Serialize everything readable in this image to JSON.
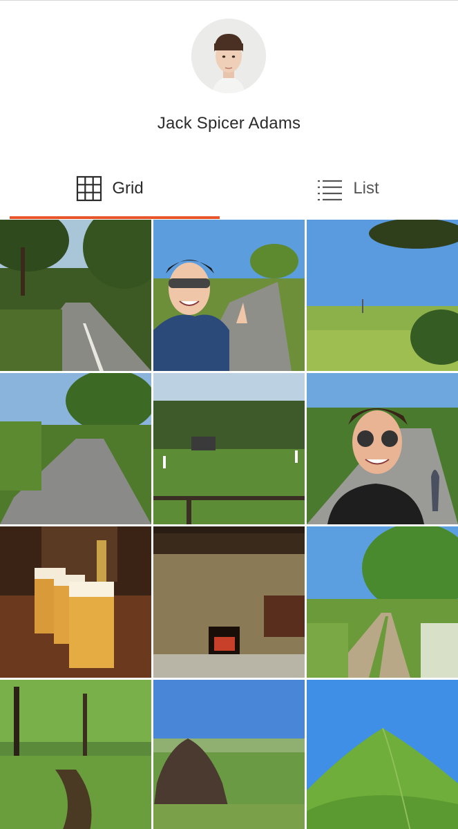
{
  "profile": {
    "name": "Jack Spicer Adams"
  },
  "tabs": {
    "grid": {
      "label": "Grid",
      "icon": "grid-icon",
      "active": true
    },
    "list": {
      "label": "List",
      "icon": "list-icon",
      "active": false
    }
  },
  "colors": {
    "accent": "#e8552a",
    "text": "#2b2b2b",
    "background": "#ffffff"
  },
  "photos": [
    {
      "subject": "country-road-trees"
    },
    {
      "subject": "cyclist-selfie"
    },
    {
      "subject": "green-field-sky"
    },
    {
      "subject": "lane-hedges"
    },
    {
      "subject": "cricket-match"
    },
    {
      "subject": "sunglasses-selfie"
    },
    {
      "subject": "pints-of-beer"
    },
    {
      "subject": "stone-fireplace"
    },
    {
      "subject": "footpath-meadow"
    },
    {
      "subject": "woodland-stream"
    },
    {
      "subject": "rocky-outcrop-view"
    },
    {
      "subject": "green-hill"
    }
  ]
}
